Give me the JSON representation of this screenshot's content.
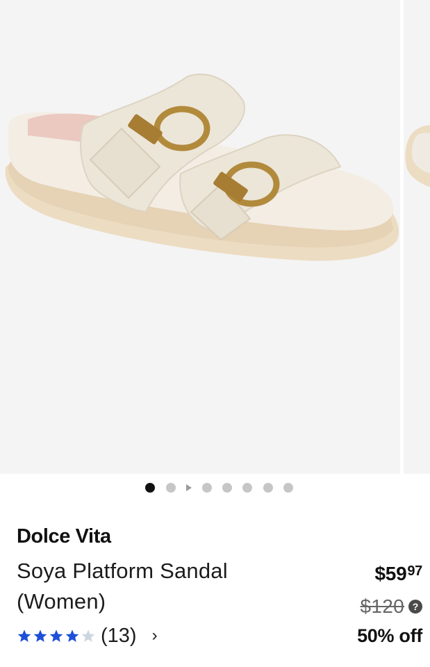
{
  "product": {
    "brand": "Dolce Vita",
    "title": "Soya Platform Sandal (Women)",
    "image_alt": "Soya Platform Sandal",
    "rating": 4,
    "rating_max": 5,
    "review_count": "(13)",
    "reviews_chevron": "›"
  },
  "pricing": {
    "currency": "$",
    "dollars": "59",
    "cents": "97",
    "original": "$120",
    "help_icon": "?",
    "discount": "50% off"
  },
  "gallery": {
    "total_slides": 8,
    "active_index": 0,
    "video_slide_index": 2
  },
  "colors": {
    "star_filled": "#1d4fd8",
    "star_empty": "#cdd6e0",
    "dot_active": "#111111",
    "dot_inactive": "#c6c6c6",
    "image_bg": "#f4f4f4"
  }
}
